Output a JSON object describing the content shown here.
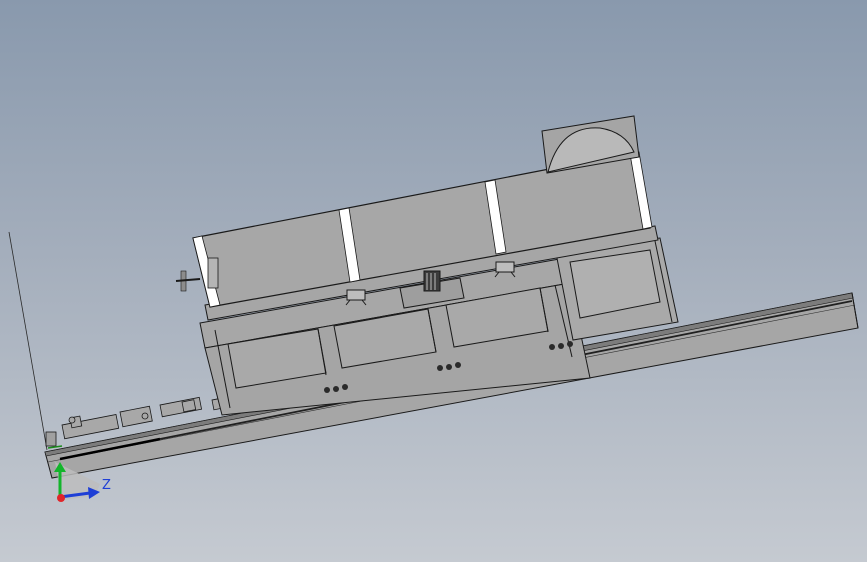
{
  "viewport": {
    "background_top": "#8999ad",
    "background_bottom": "#c5cad1"
  },
  "triad": {
    "z_label": "Z",
    "x_color": "#1e3fd6",
    "y_color": "#13b52b",
    "z_color": "#1e3fd6",
    "origin_color": "#e1252a"
  },
  "model": {
    "steel_color": "#a9a9a9",
    "steel_dark": "#8c8c8c",
    "edge_color": "#1a1a1a",
    "highlight_color": "#ffffff"
  }
}
